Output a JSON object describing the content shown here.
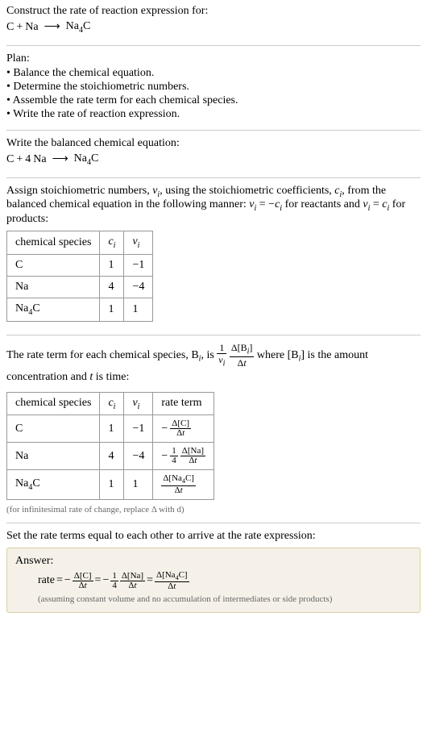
{
  "header": {
    "prompt": "Construct the rate of reaction expression for:",
    "unbalanced_lhs_1": "C",
    "plus1": "+",
    "unbalanced_lhs_2": "Na",
    "arrow": "⟶",
    "unbalanced_rhs_1a": "Na",
    "unbalanced_rhs_1a_sub": "4",
    "unbalanced_rhs_1b": "C"
  },
  "plan": {
    "title": "Plan:",
    "items": [
      "• Balance the chemical equation.",
      "• Determine the stoichiometric numbers.",
      "• Assemble the rate term for each chemical species.",
      "• Write the rate of reaction expression."
    ]
  },
  "balanced": {
    "intro": "Write the balanced chemical equation:",
    "lhs1": "C",
    "plus": "+",
    "coef2": "4",
    "lhs2": "Na",
    "arrow": "⟶",
    "rhs1a": "Na",
    "rhs1a_sub": "4",
    "rhs1b": "C"
  },
  "stoich": {
    "intro_a": "Assign stoichiometric numbers, ",
    "nu": "ν",
    "isub": "i",
    "intro_b": ", using the stoichiometric coefficients, ",
    "c": "c",
    "intro_c": ", from the balanced chemical equation in the following manner: ",
    "rel1a": "ν",
    "rel1b": " = −",
    "rel1c": "c",
    "rel1d": " for reactants and ",
    "rel2a": "ν",
    "rel2b": " = ",
    "rel2c": "c",
    "rel2d": " for products:",
    "headers": {
      "species": "chemical species",
      "ci": "c",
      "nui": "ν"
    },
    "rows": [
      {
        "species": "C",
        "c": "1",
        "nu": "−1"
      },
      {
        "species": "Na",
        "c": "4",
        "nu": "−4"
      },
      {
        "species_a": "Na",
        "species_sub": "4",
        "species_b": "C",
        "c": "1",
        "nu": "1"
      }
    ]
  },
  "rateterm": {
    "intro_a": "The rate term for each chemical species, B",
    "intro_b": ", is ",
    "one": "1",
    "nu": "ν",
    "i": "i",
    "delta": "Δ[B",
    "delta_close": "]",
    "dt": "Δt",
    "intro_c": " where [B",
    "intro_d": "] is the amount concentration and ",
    "tvar": "t",
    "intro_e": " is time:",
    "headers": {
      "species": "chemical species",
      "ci": "c",
      "nui": "ν",
      "rate": "rate term"
    },
    "rows": [
      {
        "species": "C",
        "c": "1",
        "nu": "−1",
        "minus": "−",
        "num": "Δ[C]",
        "den": "Δt"
      },
      {
        "species": "Na",
        "c": "4",
        "nu": "−4",
        "minus": "−",
        "coef_num": "1",
        "coef_den": "4",
        "num": "Δ[Na]",
        "den": "Δt"
      },
      {
        "species_a": "Na",
        "species_sub": "4",
        "species_b": "C",
        "c": "1",
        "nu": "1",
        "num_a": "Δ[Na",
        "num_sub": "4",
        "num_b": "C]",
        "den": "Δt"
      }
    ],
    "note": "(for infinitesimal rate of change, replace Δ with d)"
  },
  "final": {
    "intro": "Set the rate terms equal to each other to arrive at the rate expression:",
    "answer_label": "Answer:",
    "rate": "rate",
    "eq": " = ",
    "minus": "−",
    "t1_num": "Δ[C]",
    "t1_den": "Δt",
    "coef_num": "1",
    "coef_den": "4",
    "t2_num": "Δ[Na]",
    "t2_den": "Δt",
    "t3_num_a": "Δ[Na",
    "t3_num_sub": "4",
    "t3_num_b": "C]",
    "t3_den": "Δt",
    "assume": "(assuming constant volume and no accumulation of intermediates or side products)"
  }
}
